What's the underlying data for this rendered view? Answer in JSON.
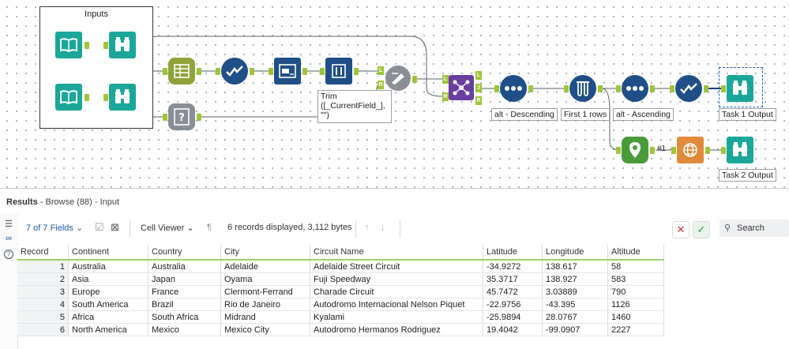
{
  "canvas": {
    "container_title": "Inputs",
    "labels": {
      "trim_formula": "Trim\n([_CurrentField_],\n\"\")",
      "sort_desc": "alt - Descending",
      "first_rows": "First 1 rows",
      "sort_asc": "alt - Ascending",
      "task1": "Task 1 Output",
      "task2": "Task 2 Output",
      "count_tag": "#1"
    },
    "anchor_letters": {
      "join_l": "L",
      "join_r": "R",
      "union_l": "L",
      "union_j": "J",
      "union_r": "R",
      "jn_in_l": "L",
      "jn_in_r": "R"
    },
    "colors": {
      "teal": "#1aa79a",
      "olive": "#8fa33a",
      "blue": "#1f4f86",
      "purple": "#6b3fa0",
      "connector": "#9fc43a"
    }
  },
  "results": {
    "title_bold": "Results",
    "title_rest": " - Browse (88) - Input",
    "fields_selector": "7 of 7 Fields",
    "viewer_selector": "Cell Viewer",
    "records_info": "6 records displayed, 3,112 bytes",
    "search_placeholder": "Search",
    "columns": [
      "Record",
      "Continent",
      "Country",
      "City",
      "Circuit Name",
      "Latitude",
      "Longitude",
      "Altitude"
    ],
    "rows": [
      [
        "1",
        "Australia",
        "Australia",
        "Adelaide",
        "Adelaide Street Circuit",
        "-34.9272",
        "138.617",
        "58"
      ],
      [
        "2",
        "Asia",
        "Japan",
        "Oyama",
        "Fuji Speedway",
        "35.3717",
        "138.927",
        "583"
      ],
      [
        "3",
        "Europe",
        "France",
        "Clermont-Ferrand",
        "Charade Circuit",
        "45.7472",
        "3.03889",
        "790"
      ],
      [
        "4",
        "South America",
        "Brazil",
        "Rio de Janeiro",
        "Autodromo Internacional Nelson Piquet",
        "-22.9756",
        "-43.395",
        "1126"
      ],
      [
        "5",
        "Africa",
        "South Africa",
        "Midrand",
        "Kyalami",
        "-25.9894",
        "28.0767",
        "1460"
      ],
      [
        "6",
        "North America",
        "Mexico",
        "Mexico City",
        "Autodromo Hermanos Rodriguez",
        "19.4042",
        "-99.0907",
        "2227"
      ]
    ]
  }
}
